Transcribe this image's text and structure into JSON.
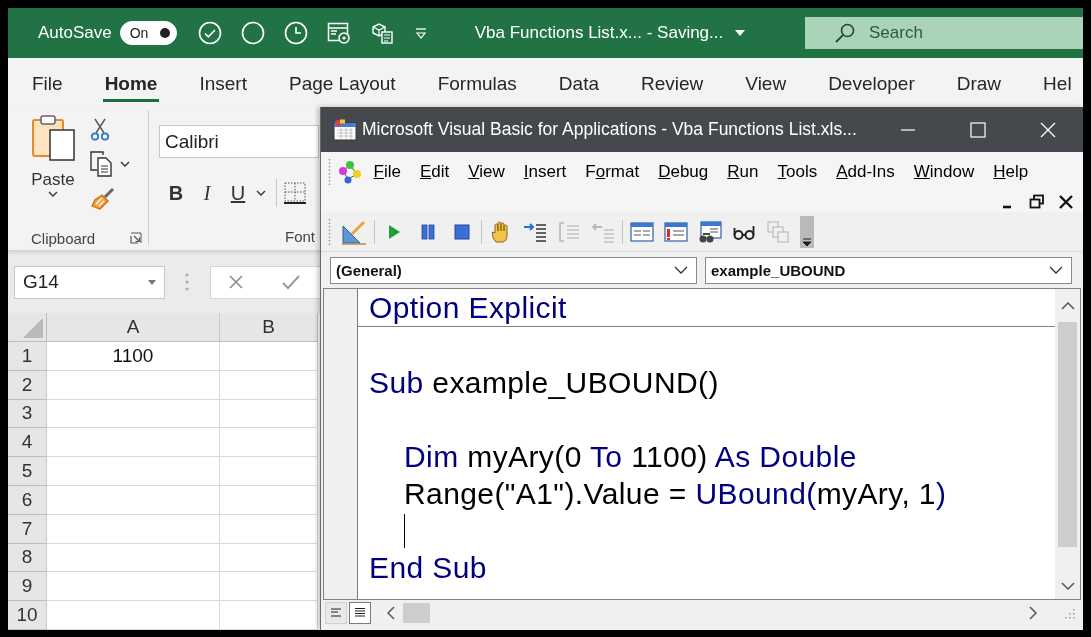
{
  "excel": {
    "title_bar": {
      "autosave": {
        "label": "AutoSave",
        "state_text": "On",
        "on": true
      },
      "document_title": "Vba Functions List.x... - Saving...",
      "search": {
        "placeholder": "Search"
      }
    },
    "ribbon_tabs": [
      {
        "label": "File",
        "selected": false
      },
      {
        "label": "Home",
        "selected": true
      },
      {
        "label": "Insert",
        "selected": false
      },
      {
        "label": "Page Layout",
        "selected": false
      },
      {
        "label": "Formulas",
        "selected": false
      },
      {
        "label": "Data",
        "selected": false
      },
      {
        "label": "Review",
        "selected": false
      },
      {
        "label": "View",
        "selected": false
      },
      {
        "label": "Developer",
        "selected": false
      },
      {
        "label": "Draw",
        "selected": false
      },
      {
        "label": "Hel",
        "selected": false
      }
    ],
    "ribbon": {
      "clipboard": {
        "paste_label": "Paste",
        "group_label": "Clipboard"
      },
      "font": {
        "font_name": {
          "value": "Calibri"
        },
        "format_buttons": [
          {
            "kind": "bold",
            "label": "B"
          },
          {
            "kind": "italic",
            "label": "I"
          },
          {
            "kind": "underline",
            "label": "U"
          }
        ],
        "group_label": "Font"
      }
    },
    "name_box": {
      "value": "G14"
    },
    "sheet": {
      "columns": [
        "A",
        "B"
      ],
      "rows": [
        {
          "number": "1",
          "values": [
            "1100"
          ]
        },
        {
          "number": "2"
        },
        {
          "number": "3"
        },
        {
          "number": "4"
        },
        {
          "number": "5"
        },
        {
          "number": "6"
        },
        {
          "number": "7"
        },
        {
          "number": "8"
        },
        {
          "number": "9"
        },
        {
          "number": "10"
        }
      ]
    }
  },
  "vbe": {
    "title": "Microsoft Visual Basic for Applications - Vba Functions List.xls...",
    "menu": [
      {
        "access_key": "F",
        "after": "ile"
      },
      {
        "access_key": "E",
        "after": "dit"
      },
      {
        "access_key": "V",
        "after": "iew"
      },
      {
        "access_key": "I",
        "after": "nsert"
      },
      {
        "before": "F",
        "access_key": "o",
        "after": "rmat"
      },
      {
        "access_key": "D",
        "after": "ebug"
      },
      {
        "access_key": "R",
        "after": "un"
      },
      {
        "access_key": "T",
        "after": "ools"
      },
      {
        "access_key": "A",
        "after": "dd-Ins"
      },
      {
        "access_key": "W",
        "after": "indow"
      },
      {
        "access_key": "H",
        "after": "elp"
      }
    ],
    "object_box": {
      "value": "(General)"
    },
    "procedure_box": {
      "value": "example_UBOUND"
    },
    "code_sections": [
      {
        "lines": [
          {
            "kind": "code",
            "tokens": [
              {
                "kind": "keyword",
                "text": "Option Explicit"
              }
            ]
          }
        ]
      },
      {
        "lines": [
          {
            "kind": "blank"
          },
          {
            "kind": "code",
            "tokens": [
              {
                "kind": "keyword",
                "text": "Sub"
              },
              {
                "kind": "plain",
                "text": " example_UBOUND()"
              }
            ],
            "children": [
              {
                "kind": "blank"
              },
              {
                "kind": "code",
                "tokens": [
                  {
                    "kind": "keyword",
                    "text": "Dim"
                  },
                  {
                    "kind": "plain",
                    "text": " myAry(0 "
                  },
                  {
                    "kind": "keyword",
                    "text": "To"
                  },
                  {
                    "kind": "plain",
                    "text": " 1100) "
                  },
                  {
                    "kind": "keyword",
                    "text": "As Double"
                  }
                ]
              },
              {
                "kind": "code",
                "tokens": [
                  {
                    "kind": "plain",
                    "text": "Range(\"A1\").Value = "
                  },
                  {
                    "kind": "keyword",
                    "text": "UBound("
                  },
                  {
                    "kind": "plain",
                    "text": "myAry, 1"
                  },
                  {
                    "kind": "keyword",
                    "text": ")"
                  }
                ]
              },
              {
                "kind": "cursor"
              }
            ]
          },
          {
            "kind": "code",
            "tokens": [
              {
                "kind": "keyword",
                "text": "End Sub"
              }
            ]
          }
        ]
      }
    ],
    "view_buttons": [
      {
        "kind": "procedure",
        "selected": false
      },
      {
        "kind": "module",
        "selected": true
      }
    ]
  }
}
